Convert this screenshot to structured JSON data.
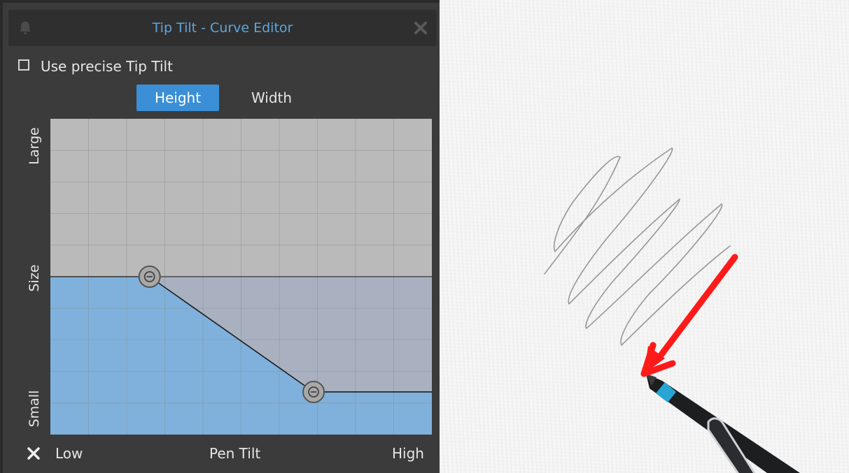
{
  "panel": {
    "title": "Tip Tilt - Curve Editor",
    "precise_checkbox": {
      "label": "Use precise Tip Tilt",
      "checked": false
    },
    "tabs": [
      {
        "label": "Height",
        "active": true
      },
      {
        "label": "Width",
        "active": false
      }
    ],
    "y_axis": {
      "top_label": "Large",
      "middle_label": "Size",
      "bottom_label": "Small"
    },
    "x_axis": {
      "left_label": "Low",
      "middle_label": "Pen Tilt",
      "right_label": "High"
    },
    "curve": {
      "grid": true,
      "points": [
        {
          "tilt": 0.0,
          "size": 0.5
        },
        {
          "tilt": 0.26,
          "size": 0.5
        },
        {
          "tilt": 0.69,
          "size": 0.135
        },
        {
          "tilt": 1.0,
          "size": 0.135
        }
      ],
      "handle_points": [
        1,
        2
      ]
    }
  },
  "colors": {
    "accent": "#3a8fd6",
    "title_text": "#5ea6dc",
    "panel_bg": "#3b3b3b",
    "graph_bg": "#bababa",
    "fill": "#7fb1dc",
    "annotation_arrow": "#ff1a1a"
  },
  "icons": {
    "pin": "bell-icon",
    "close": "close-icon",
    "reset": "reset-x-icon"
  }
}
